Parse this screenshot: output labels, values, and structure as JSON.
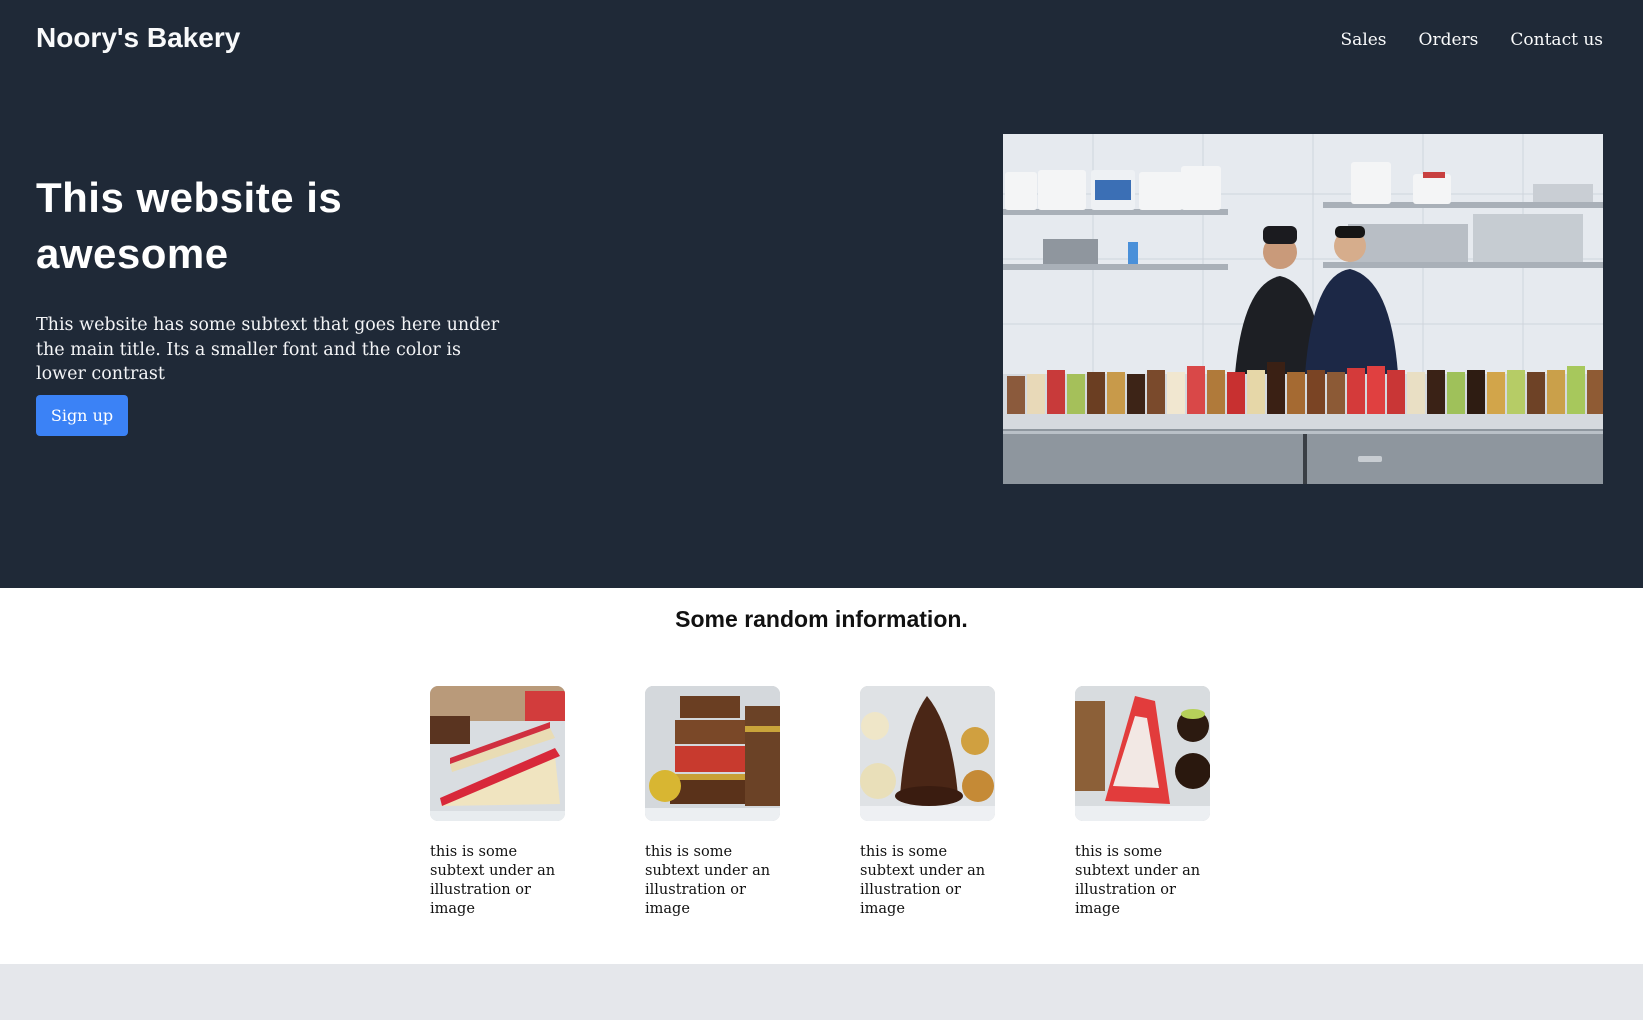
{
  "header": {
    "brand": "Noory's Bakery",
    "nav": [
      "Sales",
      "Orders",
      "Contact us"
    ]
  },
  "hero": {
    "title": "This website is awesome",
    "subtitle": "This website has some subtext that goes here under the main title. Its a smaller font and the color is lower contrast",
    "cta_label": "Sign up"
  },
  "info": {
    "title": "Some random information.",
    "cards": [
      {
        "caption": "this is some subtext under an illustration or image"
      },
      {
        "caption": "this is some subtext under an illustration or image"
      },
      {
        "caption": "this is some subtext under an illustration or image"
      },
      {
        "caption": "this is some subtext under an illustration or image"
      }
    ]
  },
  "colors": {
    "hero_bg": "#1f2937",
    "accent": "#3b82f6",
    "footer_bg": "#e5e7eb"
  }
}
